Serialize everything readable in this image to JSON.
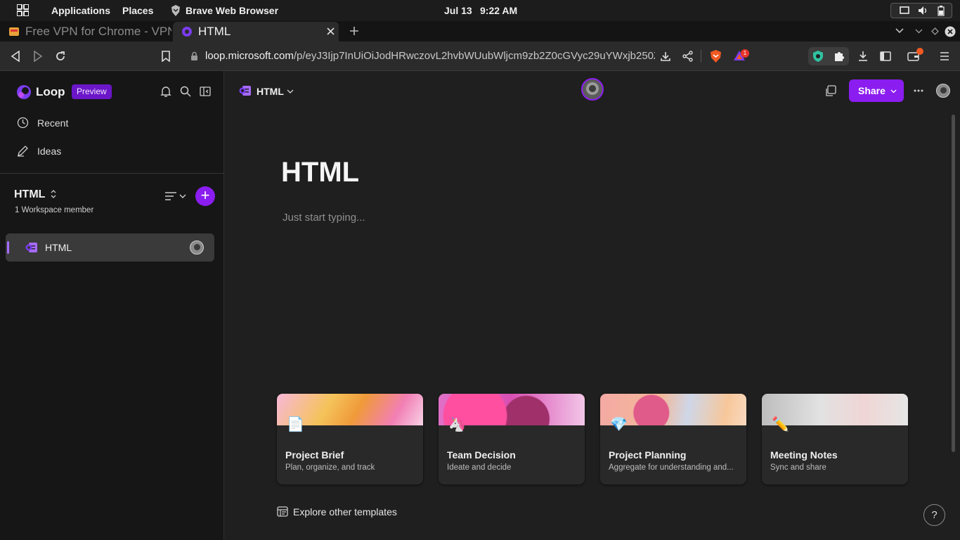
{
  "desktop": {
    "applications_label": "Applications",
    "places_label": "Places",
    "active_app": "Brave Web Browser",
    "date": "Jul 13",
    "time": "9:22 AM"
  },
  "browser": {
    "tabs": [
      {
        "label": "Free VPN for Chrome - VPN Proxy VeePN",
        "active": false
      },
      {
        "label": "HTML",
        "active": true
      }
    ],
    "address_host": "loop.microsoft.com",
    "address_path": "/p/eyJ3Ijp7InUiOiJodHRwczovL2hvbWUubWljcm9zb2Z0cGVyc29uYWxjb250ZW...",
    "extension_badge": "1"
  },
  "sidebar": {
    "app_name": "Loop",
    "preview_badge": "Preview",
    "nav": [
      {
        "label": "Recent",
        "icon": "clock-icon"
      },
      {
        "label": "Ideas",
        "icon": "pen-icon"
      }
    ],
    "workspace": {
      "title": "HTML",
      "members": "1 Workspace member"
    },
    "pages": [
      {
        "label": "HTML"
      }
    ]
  },
  "main": {
    "breadcrumb": "HTML",
    "share_label": "Share",
    "title": "HTML",
    "placeholder": "Just start typing...",
    "templates": [
      {
        "title": "Project Brief",
        "description": "Plan, organize, and track",
        "emoji": "📄",
        "color": "#f7b8d8"
      },
      {
        "title": "Team Decision",
        "description": "Ideate and decide",
        "emoji": "🦄",
        "color": "#d94fb3"
      },
      {
        "title": "Project Planning",
        "description": "Aggregate for understanding and...",
        "emoji": "💎",
        "color": "#f4a9a3"
      },
      {
        "title": "Meeting Notes",
        "description": "Sync and share",
        "emoji": "✏️",
        "color": "#d6d6d6"
      }
    ],
    "explore_label": "Explore other templates",
    "help_label": "?"
  },
  "colors": {
    "accent": "#8b1df0",
    "sidebar_bg": "#161616",
    "main_bg": "#1f1f1f"
  }
}
